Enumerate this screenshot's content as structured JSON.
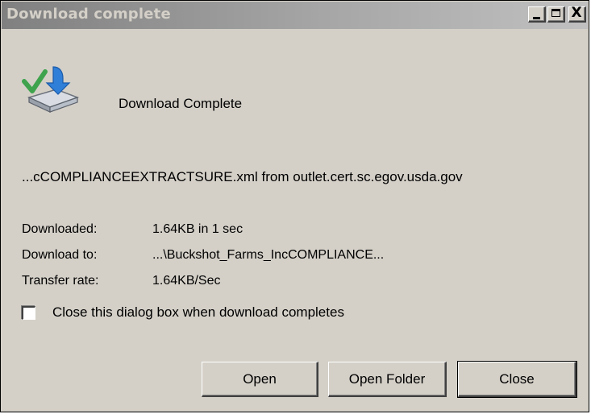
{
  "window": {
    "title": "Download complete",
    "controls": {
      "minimize_icon": "minimize-icon",
      "maximize_icon": "maximize-icon",
      "close_icon": "close-icon",
      "close_glyph": "X"
    }
  },
  "dialog": {
    "icon": "download-complete-icon",
    "header": "Download Complete",
    "file_line": "...cCOMPLIANCEEXTRACTSURE.xml from outlet.cert.sc.egov.usda.gov",
    "info": [
      {
        "label": "Downloaded:",
        "value": "1.64KB in 1 sec"
      },
      {
        "label": "Download to:",
        "value": "...\\Buckshot_Farms_IncCOMPLIANCE..."
      },
      {
        "label": "Transfer rate:",
        "value": "1.64KB/Sec"
      }
    ],
    "checkbox": {
      "label": "Close this dialog box when download completes",
      "checked": false
    },
    "buttons": {
      "open": "Open",
      "open_folder": "Open Folder",
      "close": "Close"
    }
  },
  "colors": {
    "face": "#d4d0c8",
    "titlebar_inactive_start": "#808080",
    "titlebar_inactive_end": "#c0c0c0",
    "title_text": "#d4d0c8"
  }
}
